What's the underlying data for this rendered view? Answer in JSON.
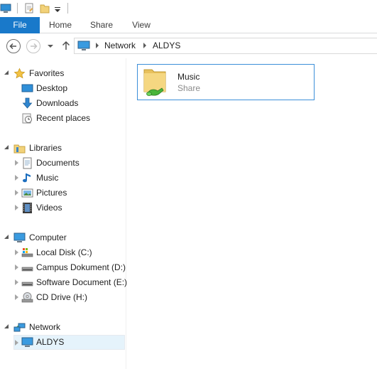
{
  "ribbon": {
    "tabs": [
      "File",
      "Home",
      "Share",
      "View"
    ]
  },
  "address": {
    "crumbs": [
      "Network",
      "ALDYS"
    ]
  },
  "nav": {
    "favorites": {
      "label": "Favorites",
      "items": [
        "Desktop",
        "Downloads",
        "Recent places"
      ]
    },
    "libraries": {
      "label": "Libraries",
      "items": [
        "Documents",
        "Music",
        "Pictures",
        "Videos"
      ]
    },
    "computer": {
      "label": "Computer",
      "items": [
        "Local Disk (C:)",
        "Campus Dokument (D:)",
        "Software Document (E:)",
        "CD Drive (H:)"
      ]
    },
    "network": {
      "label": "Network",
      "items": [
        "ALDYS"
      ]
    }
  },
  "content": {
    "items": [
      {
        "name": "Music",
        "type": "Share",
        "icon": "shared-folder-icon"
      }
    ]
  },
  "colors": {
    "file_tab": "#1979ca",
    "selection": "#e5f3fb",
    "tile_border": "#3c8fd9"
  }
}
